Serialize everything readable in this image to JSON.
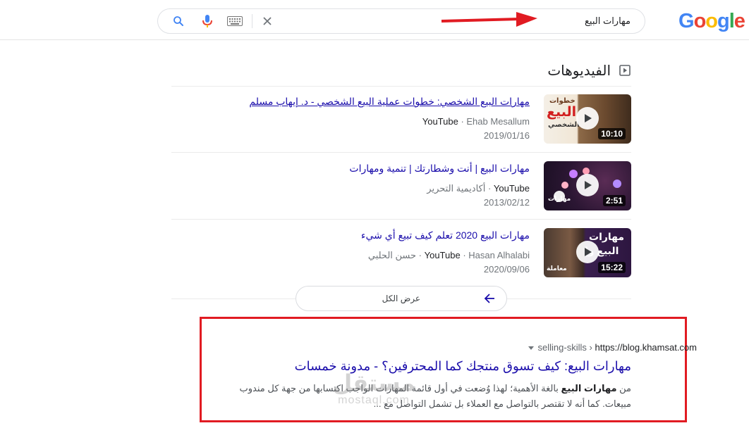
{
  "header": {
    "logo": [
      "G",
      "o",
      "o",
      "g",
      "l",
      "e"
    ],
    "logo_colors": [
      "#4285F4",
      "#EA4335",
      "#FBBC05",
      "#4285F4",
      "#34A853",
      "#EA4335"
    ],
    "query": "مهارات البيع",
    "icons": [
      "close-icon",
      "keyboard-icon",
      "mic-icon",
      "search-icon"
    ]
  },
  "videos": {
    "title": "الفيديوهات",
    "items": [
      {
        "title": "مهارات البيع الشخصي: خطوات عملية البيع الشخصي - د. إيهاب مسلم",
        "source": "YouTube",
        "author": "Ehab Mesallum",
        "date": "2019/01/16",
        "duration": "10:10",
        "thumb_text_1": "خطوات",
        "thumb_text_2": "البيع",
        "thumb_text_3": "الشخصي"
      },
      {
        "title": "مهارات البيع | أنت وشطارتك | تنمية ومهارات",
        "source": "YouTube",
        "author": "أكاديمية التحرير",
        "date": "2013/02/12",
        "duration": "2:51",
        "thumb_text_1": "مهارات"
      },
      {
        "title": "مهارات البيع 2020 تعلم كيف تبيع أي شيء",
        "source": "YouTube",
        "author": "Hasan Alhalabi · حسن الحلبي",
        "date": "2020/09/06",
        "duration": "15:22",
        "thumb_text_1": "مهارات",
        "thumb_text_2": "البيع وإ",
        "thumb_text_3": "معاملة"
      }
    ],
    "show_all": "عرض الكل"
  },
  "result": {
    "url": "https://blog.khamsat.com",
    "crumb": "selling-skills",
    "title": "مهارات البيع: كيف تسوق منتجك كما المحترفين؟ - مدونة خمسات",
    "snippet_prefix": "من",
    "snippet_bold": "مهارات البيع",
    "snippet_rest": "بالغة الأهمية؛ لهذا وُضعت في أول قائمة المهارات الواجب اكتسابها من جهة كل مندوب مبيعات. كما أنه لا تقتصر بالتواصل مع العملاء بل تشمل التواصل مع ..."
  },
  "watermark": {
    "arabic": "مستقل",
    "latin": "mostaql.com"
  },
  "colors": {
    "link": "#1a0dab",
    "annotation_red": "#e11b22"
  }
}
